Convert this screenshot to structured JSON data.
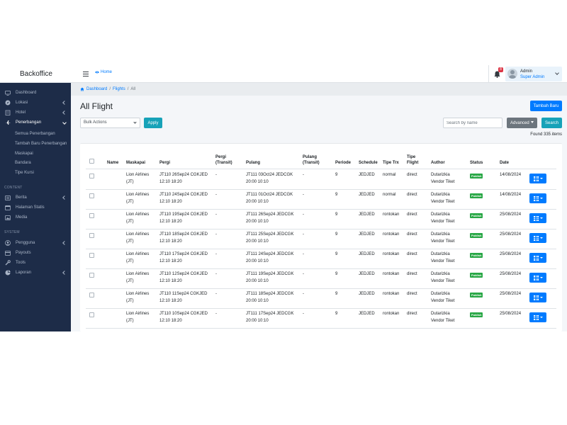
{
  "brand": "Backoffice",
  "topbar": {
    "home_label": "Home",
    "notification_count": "8",
    "user_name": "Admin",
    "user_role": "Super Admin"
  },
  "sidebar": {
    "items": [
      {
        "label": "Dashboard",
        "icon": "monitor-icon",
        "has_chevron": false
      },
      {
        "label": "Lokasi",
        "icon": "compass-icon",
        "has_chevron": true
      },
      {
        "label": "Hotel",
        "icon": "building-icon",
        "has_chevron": true
      },
      {
        "label": "Penerbangan",
        "icon": "plane-icon",
        "has_chevron": true,
        "active": true
      }
    ],
    "penerbangan_sub": [
      "Semua Penerbangan",
      "Tambah Baru Penerbangan",
      "Maskapai",
      "Bandara",
      "Tipe Kursi"
    ],
    "content_header": "CONTENT",
    "content_items": [
      {
        "label": "Berita",
        "icon": "list-icon",
        "has_chevron": true
      },
      {
        "label": "Halaman Statis",
        "icon": "file-icon",
        "has_chevron": false
      },
      {
        "label": "Media",
        "icon": "image-icon",
        "has_chevron": false
      }
    ],
    "system_header": "SYSTEM",
    "system_items": [
      {
        "label": "Pengguna",
        "icon": "users-icon",
        "has_chevron": true
      },
      {
        "label": "Payouts",
        "icon": "wallet-icon",
        "has_chevron": false
      },
      {
        "label": "Tools",
        "icon": "wrench-icon",
        "has_chevron": false
      },
      {
        "label": "Laporan",
        "icon": "chart-icon",
        "has_chevron": true
      }
    ]
  },
  "breadcrumb": {
    "dashboard": "Dashboard",
    "sep1": "/",
    "flights": "Flights",
    "sep2": "/",
    "current": "All"
  },
  "page": {
    "title": "All Flight",
    "add_button": "Tambah Baru",
    "bulk_select_value": "Bulk Actions",
    "apply_button": "Apply",
    "search_placeholder": "Search by name",
    "advanced_button": "Advanced",
    "search_button": "Search",
    "found_prefix": "Found 335 ",
    "found_suffix": "items"
  },
  "table": {
    "headers": {
      "name": "Name",
      "maskapai": "Maskapai",
      "pergi": "Pergi",
      "pergi_transit_1": "Pergi",
      "pergi_transit_2": "(Transit)",
      "pulang": "Pulang",
      "pulang_transit_1": "Pulang",
      "pulang_transit_2": "(Transit)",
      "periode": "Periode",
      "schedule": "Schedule",
      "tipe_trx": "Tipe Trx",
      "tipe_flight_1": "Tipe",
      "tipe_flight_2": "Flight",
      "author": "Author",
      "status": "Status",
      "date": "Date"
    },
    "rows": [
      {
        "name": "",
        "maskapai_1": "Lion Airlines",
        "maskapai_2": "(JT)",
        "pergi_1": "JT110 26Sep24 CGKJED",
        "pergi_2": "12:10 18:20",
        "pergi_transit": "-",
        "pulang_1": "JT111 03Oct24 JEDCGK",
        "pulang_2": "20:00 10:10",
        "pulang_transit": "-",
        "periode": "9",
        "schedule": "JEDJED",
        "tipe_trx": "normal",
        "tipe_flight": "direct",
        "author_1": "Dutarizkia",
        "author_2": "Vendor Tiket",
        "status": "Publish",
        "date": "14/08/2024"
      },
      {
        "name": "",
        "maskapai_1": "Lion Airlines",
        "maskapai_2": "(JT)",
        "pergi_1": "JT110 24Sep24 CGKJED",
        "pergi_2": "12:10 18:20",
        "pergi_transit": "-",
        "pulang_1": "JT111 01Oct24 JEDCGK",
        "pulang_2": "20:00 10:10",
        "pulang_transit": "-",
        "periode": "9",
        "schedule": "JEDJED",
        "tipe_trx": "normal",
        "tipe_flight": "direct",
        "author_1": "Dutarizkia",
        "author_2": "Vendor Tiket",
        "status": "Publish",
        "date": "14/08/2024"
      },
      {
        "name": "",
        "maskapai_1": "Lion Airlines",
        "maskapai_2": "(JT)",
        "pergi_1": "JT110 19Sep24 CGKJED",
        "pergi_2": "12:10 18:20",
        "pergi_transit": "-",
        "pulang_1": "JT111 26Sep24 JEDCGK",
        "pulang_2": "20:00 10:10",
        "pulang_transit": "-",
        "periode": "9",
        "schedule": "JEDJED",
        "tipe_trx": "rontokan",
        "tipe_flight": "direct",
        "author_1": "Dutarizkia",
        "author_2": "Vendor Tiket",
        "status": "Publish",
        "date": "25/08/2024"
      },
      {
        "name": "",
        "maskapai_1": "Lion Airlines",
        "maskapai_2": "(JT)",
        "pergi_1": "JT110 18Sep24 CGKJED",
        "pergi_2": "12:10 18:20",
        "pergi_transit": "-",
        "pulang_1": "JT111 25Sep24 JEDCGK",
        "pulang_2": "20:00 10:10",
        "pulang_transit": "-",
        "periode": "9",
        "schedule": "JEDJED",
        "tipe_trx": "rontokan",
        "tipe_flight": "direct",
        "author_1": "Dutarizkia",
        "author_2": "Vendor Tiket",
        "status": "Publish",
        "date": "25/08/2024"
      },
      {
        "name": "",
        "maskapai_1": "Lion Airlines",
        "maskapai_2": "(JT)",
        "pergi_1": "JT110 17Sep24 CGKJED",
        "pergi_2": "12:10 18:20",
        "pergi_transit": "-",
        "pulang_1": "JT111 24Sep24 JEDCGK",
        "pulang_2": "20:00 10:10",
        "pulang_transit": "-",
        "periode": "9",
        "schedule": "JEDJED",
        "tipe_trx": "rontokan",
        "tipe_flight": "direct",
        "author_1": "Dutarizkia",
        "author_2": "Vendor Tiket",
        "status": "Publish",
        "date": "25/08/2024"
      },
      {
        "name": "",
        "maskapai_1": "Lion Airlines",
        "maskapai_2": "(JT)",
        "pergi_1": "JT110 12Sep24 CGKJED",
        "pergi_2": "12:10 18:20",
        "pergi_transit": "-",
        "pulang_1": "JT111 19Sep24 JEDCGK",
        "pulang_2": "20:00 10:10",
        "pulang_transit": "-",
        "periode": "9",
        "schedule": "JEDJED",
        "tipe_trx": "rontokan",
        "tipe_flight": "direct",
        "author_1": "Dutarizkia",
        "author_2": "Vendor Tiket",
        "status": "Publish",
        "date": "25/08/2024"
      },
      {
        "name": "",
        "maskapai_1": "Lion Airlines",
        "maskapai_2": "(JT)",
        "pergi_1": "JT110 11Sep24 CGKJED",
        "pergi_2": "12:10 18:20",
        "pergi_transit": "-",
        "pulang_1": "JT111 18Sep24 JEDCGK",
        "pulang_2": "20:00 10:10",
        "pulang_transit": "-",
        "periode": "9",
        "schedule": "JEDJED",
        "tipe_trx": "rontokan",
        "tipe_flight": "direct",
        "author_1": "Dutarizkia",
        "author_2": "Vendor Tiket",
        "status": "Publish",
        "date": "25/08/2024"
      },
      {
        "name": "",
        "maskapai_1": "Lion Airlines",
        "maskapai_2": "(JT)",
        "pergi_1": "JT110 10Sep24 CGKJED",
        "pergi_2": "12:10 18:20",
        "pergi_transit": "-",
        "pulang_1": "JT111 17Sep24 JEDCGK",
        "pulang_2": "20:00 10:10",
        "pulang_transit": "-",
        "periode": "9",
        "schedule": "JEDJED",
        "tipe_trx": "rontokan",
        "tipe_flight": "direct",
        "author_1": "Dutarizkia",
        "author_2": "Vendor Tiket",
        "status": "Publish",
        "date": "25/08/2024"
      }
    ]
  },
  "colors": {
    "primary": "#007bff",
    "info": "#17a2b8",
    "secondary": "#6c757d",
    "success": "#28a745",
    "danger": "#dc3545",
    "sidebar": "#1d2c48"
  }
}
